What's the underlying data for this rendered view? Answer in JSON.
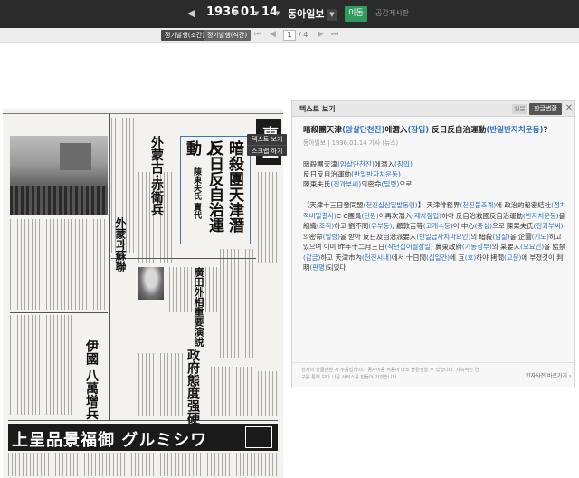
{
  "topbar": {
    "year": "1936",
    "month": "01",
    "day": "14",
    "newspaper": "동아일보",
    "move_button": "이동",
    "notice_link": "공감게시판",
    "prev_icon": "triangle-left-icon",
    "next_icon": "triangle-right-icon"
  },
  "subbar": {
    "edition_tabs": [
      "정기발행(조간)",
      "정기발행(석간)"
    ],
    "current_page": "1",
    "total_pages": "/ 4"
  },
  "context_menu": {
    "items": [
      "텍스트 보기",
      "스크랩 하기"
    ]
  },
  "newspaper_image": {
    "masthead": "東亞",
    "headlines": {
      "main": "暗殺團天津潛入",
      "sub": "反日反自治運動",
      "small": "陳東夫氏 賣代",
      "col2": "外蒙古·赤衛兵",
      "col3": "外蒙과蘇聯",
      "col4": "廣田外相重要演說",
      "col5": "政府態度强硬",
      "col6": "伊國 八萬增兵"
    },
    "ad_text": "上呈品景福御 グルミシワ"
  },
  "text_panel": {
    "title": "텍스트 보기",
    "btn_original": "원문",
    "btn_convert": "한글변환",
    "article": {
      "title_parts": [
        {
          "t": "暗殺團天津",
          "h": false
        },
        {
          "t": "(암살단천진)",
          "h": true
        },
        {
          "t": "에潛入",
          "h": false
        },
        {
          "t": "(잠입)",
          "h": true
        },
        {
          "t": " 反日反自治運動",
          "h": false
        },
        {
          "t": "(반일반자치운동)",
          "h": true
        },
        {
          "t": "?",
          "h": false
        }
      ],
      "meta": "동아일보 | 1936.01.14 기사 (뉴스)",
      "sub_lines": [
        [
          {
            "t": "暗殺團天津",
            "h": false
          },
          {
            "t": "(암살단천진)",
            "h": true
          },
          {
            "t": "에潛入",
            "h": false
          },
          {
            "t": "(잠입)",
            "h": true
          }
        ],
        [
          {
            "t": "反日反自治運動",
            "h": false
          },
          {
            "t": "(반일반자치운동)",
            "h": true
          }
        ],
        [
          {
            "t": "陳東夫氏",
            "h": false
          },
          {
            "t": "(진과부씨)",
            "h": true
          },
          {
            "t": "의密命",
            "h": false
          },
          {
            "t": "(밀령)",
            "h": true
          },
          {
            "t": "으로",
            "h": false
          }
        ]
      ],
      "body": [
        {
          "t": "【天津十三日發同盟",
          "h": false
        },
        {
          "t": "(천진십삼일발동맹)",
          "h": true
        },
        {
          "t": "】 天津俳務界",
          "h": false
        },
        {
          "t": "(천진불조계)",
          "h": true
        },
        {
          "t": "에 政治的秘密結社",
          "h": false
        },
        {
          "t": "(정치적비밀결사)",
          "h": true
        },
        {
          "t": "C C團員",
          "h": false
        },
        {
          "t": "(단원)",
          "h": true
        },
        {
          "t": "이再次潛入",
          "h": false
        },
        {
          "t": "(재차잠입)",
          "h": true
        },
        {
          "t": "하야 反自治救國反自治運動",
          "h": false
        },
        {
          "t": "(반자치운동)",
          "h": true
        },
        {
          "t": "을 組織",
          "h": false
        },
        {
          "t": "(조직)",
          "h": true
        },
        {
          "t": "하고 劉不同",
          "h": false
        },
        {
          "t": "(유부동)",
          "h": true
        },
        {
          "t": ", 顧敦吉等",
          "h": false
        },
        {
          "t": "(고개수등)",
          "h": true
        },
        {
          "t": "이 中心",
          "h": false
        },
        {
          "t": "(중심)",
          "h": true
        },
        {
          "t": "으로 陳果夫氏",
          "h": false
        },
        {
          "t": "(진과부씨)",
          "h": true
        },
        {
          "t": "의密命",
          "h": false
        },
        {
          "t": "(밀령)",
          "h": true
        },
        {
          "t": "을 받아 反日及自治派要人",
          "h": false
        },
        {
          "t": "(반일급자치파요인)",
          "h": true
        },
        {
          "t": "의 暗殺",
          "h": false
        },
        {
          "t": "(암살)",
          "h": true
        },
        {
          "t": "을 企圖",
          "h": false
        },
        {
          "t": "(기도)",
          "h": true
        },
        {
          "t": "하고있으며 이미 昨年十二月三日",
          "h": false
        },
        {
          "t": "(작년십이월삼일)",
          "h": true
        },
        {
          "t": " 冀東政府",
          "h": false
        },
        {
          "t": "(기동정부)",
          "h": true
        },
        {
          "t": "의 某要人",
          "h": false
        },
        {
          "t": "(모요인)",
          "h": true
        },
        {
          "t": "을 監禁",
          "h": false
        },
        {
          "t": "(감금)",
          "h": true
        },
        {
          "t": "하고 天津市內",
          "h": false
        },
        {
          "t": "(천진시내)",
          "h": true
        },
        {
          "t": "에서 十日間",
          "h": false
        },
        {
          "t": "(십일간)",
          "h": true
        },
        {
          "t": "에 互",
          "h": false
        },
        {
          "t": "(호)",
          "h": true
        },
        {
          "t": "하야 拷問",
          "h": false
        },
        {
          "t": "(고문)",
          "h": true
        },
        {
          "t": "에 부쳤것이 判明",
          "h": false
        },
        {
          "t": "(판명)",
          "h": true
        },
        {
          "t": "되었다",
          "h": false
        }
      ]
    },
    "footer_note": "한자의 한글변환 시 두음법칙이나 동자이음 적용이 다소 불완전할 수 있습니다. 지속적인 연구를 통해 보다 나은 서비스를 만들어 가겠습니다.",
    "footer_link": "한자사전 바로가기 ›"
  },
  "colors": {
    "topbar_bg": "#2b2b2b",
    "move_button": "#2f9b5e",
    "highlight_blue": "#2a6fc9",
    "convert_button": "#555555"
  }
}
